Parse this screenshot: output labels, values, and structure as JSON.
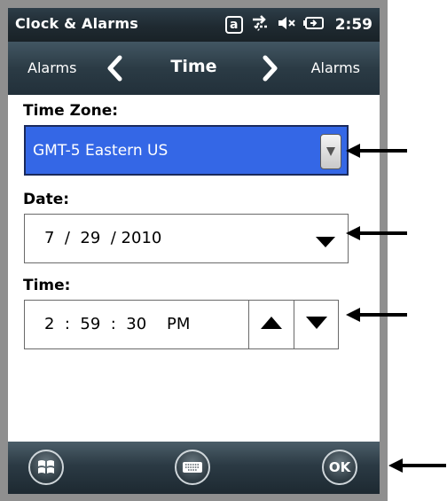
{
  "status_bar": {
    "title": "Clock & Alarms",
    "icons": [
      "a-keyboard-indicator-icon",
      "connectivity-icon",
      "volume-muted-icon",
      "battery-charging-icon"
    ],
    "a_indicator": "a",
    "time": "2:59"
  },
  "nav": {
    "prev_label": "Alarms",
    "title": "Time",
    "next_label": "Alarms"
  },
  "time_zone": {
    "label": "Time Zone:",
    "value": "GMT-5 Eastern US"
  },
  "date": {
    "label": "Date:",
    "value": "7  /  29  / 2010"
  },
  "time": {
    "label": "Time:",
    "value": "2  :  59  :  30    PM"
  },
  "bottom_bar": {
    "ok_label": "OK",
    "icons": [
      "windows-start-icon",
      "keyboard-icon"
    ]
  },
  "colors": {
    "selection_blue": "#3467e6",
    "bar_dark": "#22303a"
  }
}
